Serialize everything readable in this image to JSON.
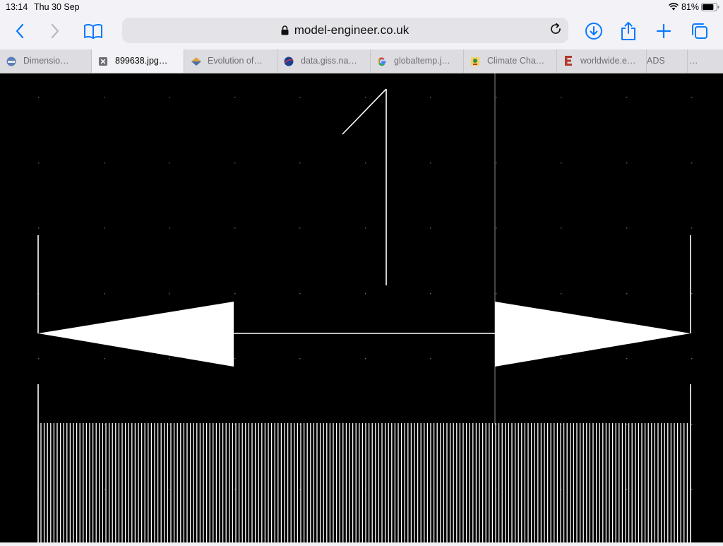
{
  "status_bar": {
    "time": "13:14",
    "date": "Thu 30 Sep",
    "battery_percent": "81%",
    "battery_level": 0.81
  },
  "toolbar": {
    "url": "model-engineer.co.uk",
    "icons": [
      "chevron-left-icon",
      "chevron-right-icon",
      "book-icon",
      "lock-icon",
      "reload-icon",
      "download-icon",
      "share-icon",
      "plus-icon",
      "tabs-icon"
    ]
  },
  "tabs": [
    {
      "title": "Dimensio…",
      "icon": "site-favicon-globe",
      "active": false
    },
    {
      "title": "899638.jpg…",
      "icon": "close-x-icon",
      "active": true
    },
    {
      "title": "Evolution of…",
      "icon": "pyramid-favicon",
      "active": false
    },
    {
      "title": "data.giss.na…",
      "icon": "nasa-favicon",
      "active": false
    },
    {
      "title": "globaltemp.j…",
      "icon": "google-favicon",
      "active": false
    },
    {
      "title": "Climate Cha…",
      "icon": "climate-favicon",
      "active": false
    },
    {
      "title": "worldwide.e…",
      "icon": "letter-e-favicon",
      "active": false
    },
    {
      "title": "ADS",
      "icon": "",
      "active": false
    },
    {
      "title": "…",
      "icon": "",
      "active": false
    }
  ],
  "colors": {
    "chrome_bg": "#f2f2f7",
    "tab_strip_bg": "#dcdce1",
    "accent": "#0a7aff",
    "content_bg": "#000000",
    "drawing": "#ffffff"
  }
}
